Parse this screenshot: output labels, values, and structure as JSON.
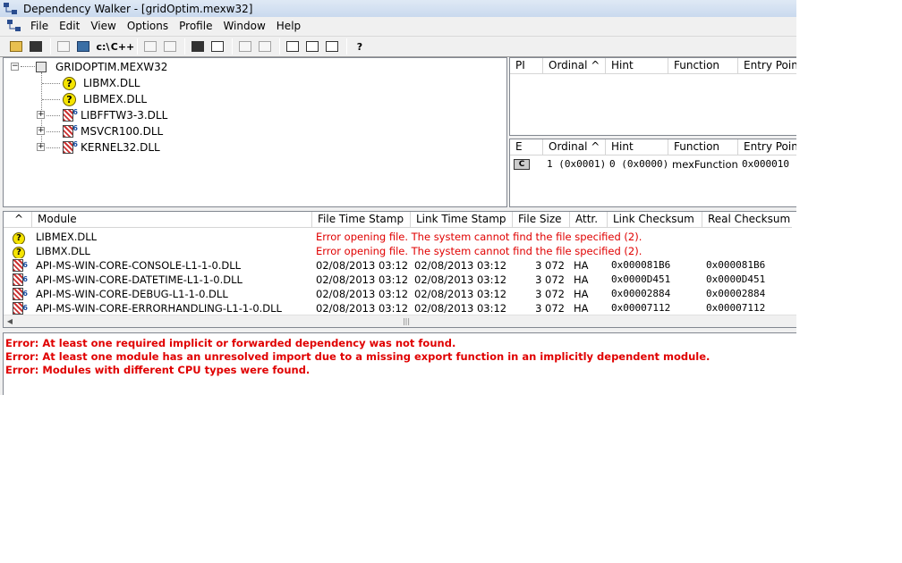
{
  "window": {
    "title": "Dependency Walker - [gridOptim.mexw32]"
  },
  "menu": [
    {
      "label": "File"
    },
    {
      "label": "Edit"
    },
    {
      "label": "View"
    },
    {
      "label": "Options"
    },
    {
      "label": "Profile"
    },
    {
      "label": "Window"
    },
    {
      "label": "Help"
    }
  ],
  "toolbar": {
    "full_paths_label": "c:\\",
    "undecorate_label": "C++",
    "help_label": "?"
  },
  "tree": {
    "root": "GRIDOPTIM.MEXW32",
    "children": [
      {
        "label": "LIBMX.DLL",
        "icon": "missing-module-icon",
        "expandable": false
      },
      {
        "label": "LIBMEX.DLL",
        "icon": "missing-module-icon",
        "expandable": false
      },
      {
        "label": "LIBFFTW3-3.DLL",
        "icon": "module-64bit-icon",
        "expandable": true
      },
      {
        "label": "MSVCR100.DLL",
        "icon": "module-64bit-icon",
        "expandable": true
      },
      {
        "label": "KERNEL32.DLL",
        "icon": "module-64bit-icon",
        "expandable": true
      }
    ]
  },
  "imports": {
    "headers": [
      "PI",
      "Ordinal ^",
      "Hint",
      "Function",
      "Entry Point"
    ]
  },
  "exports": {
    "headers": [
      "E",
      "Ordinal ^",
      "Hint",
      "Function",
      "Entry Point"
    ],
    "rows": [
      {
        "type": "C",
        "ordinal": "1 (0x0001)",
        "hint": "0 (0x0000)",
        "function": "mexFunction",
        "entry": "0x000010"
      }
    ]
  },
  "modules": {
    "headers": [
      "^",
      "Module",
      "File Time Stamp",
      "Link Time Stamp",
      "File Size",
      "Attr.",
      "Link Checksum",
      "Real Checksum"
    ],
    "rows": [
      {
        "icon": "missing-module-icon",
        "module": "LIBMEX.DLL",
        "error": "Error opening file. The system cannot find the file specified (2)."
      },
      {
        "icon": "missing-module-icon",
        "module": "LIBMX.DLL",
        "error": "Error opening file. The system cannot find the file specified (2)."
      },
      {
        "icon": "module-64bit-icon",
        "module": "API-MS-WIN-CORE-CONSOLE-L1-1-0.DLL",
        "file_ts": "02/08/2013 03:12",
        "link_ts": "02/08/2013 03:12",
        "size": "3 072",
        "attr": "HA",
        "link_cs": "0x000081B6",
        "real_cs": "0x000081B6"
      },
      {
        "icon": "module-64bit-icon",
        "module": "API-MS-WIN-CORE-DATETIME-L1-1-0.DLL",
        "file_ts": "02/08/2013 03:12",
        "link_ts": "02/08/2013 03:12",
        "size": "3 072",
        "attr": "HA",
        "link_cs": "0x0000D451",
        "real_cs": "0x0000D451"
      },
      {
        "icon": "module-64bit-icon",
        "module": "API-MS-WIN-CORE-DEBUG-L1-1-0.DLL",
        "file_ts": "02/08/2013 03:12",
        "link_ts": "02/08/2013 03:12",
        "size": "3 072",
        "attr": "HA",
        "link_cs": "0x00002884",
        "real_cs": "0x00002884"
      },
      {
        "icon": "module-64bit-icon",
        "module": "API-MS-WIN-CORE-ERRORHANDLING-L1-1-0.DLL",
        "file_ts": "02/08/2013 03:12",
        "link_ts": "02/08/2013 03:12",
        "size": "3 072",
        "attr": "HA",
        "link_cs": "0x00007112",
        "real_cs": "0x00007112"
      }
    ]
  },
  "log": [
    "Error: At least one required implicit or forwarded dependency was not found.",
    "Error: At least one module has an unresolved import due to a missing export function in an implicitly dependent module.",
    "Error: Modules with different CPU types were found."
  ],
  "colors": {
    "error": "#e00000"
  }
}
